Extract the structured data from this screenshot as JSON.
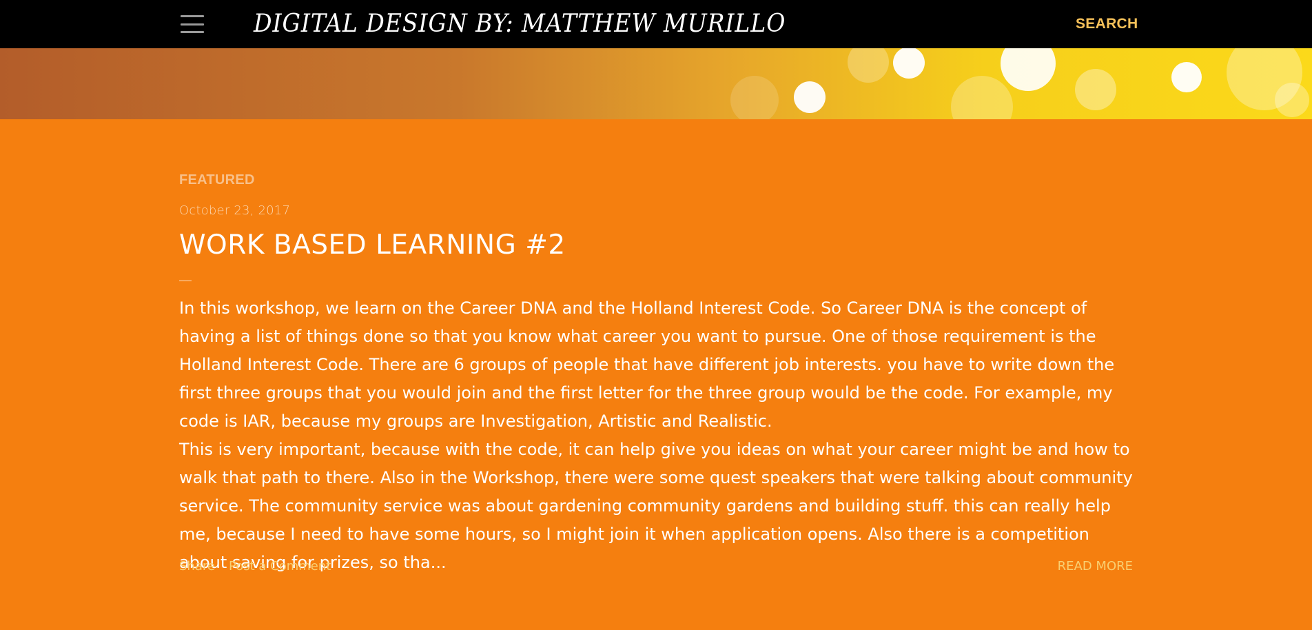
{
  "header": {
    "title": "DIGITAL DESIGN BY: MATTHEW MURILLO",
    "menu_icon": "hamburger-menu-icon",
    "search_label": "SEARCH"
  },
  "colors": {
    "page_background": "#f57f0f",
    "header_background": "#000000",
    "accent": "#f7c25a"
  },
  "featured": {
    "label": "FEATURED",
    "post": {
      "date": "October 23, 2017",
      "title": "WORK BASED LEARNING #2",
      "rule": "—",
      "paragraphs": [
        "In this workshop, we learn on the Career DNA and the Holland Interest Code. So Career DNA is the concept of having a list of things done so that you know what career you want to pursue. One of those requirement is the Holland Interest Code. There are 6 groups of people that have different job interests. you have to write down the first three groups that you would join and the first letter for the three group would be the code. For example, my code is IAR, because my groups are Investigation, Artistic and Realistic.",
        "This is very important, because with the code, it can help give you ideas on what your career might be and how to walk that path to there. Also in the Workshop, there were some quest speakers that were talking about community service. The community service was about gardening community gardens and building stuff. this can really help me, because I need to have some hours, so I might join it when application opens. Also there is a competition about saving for prizes, so tha..."
      ],
      "share_label": "Share",
      "comment_label": "Post a Comment",
      "read_more_label": "READ MORE"
    }
  }
}
